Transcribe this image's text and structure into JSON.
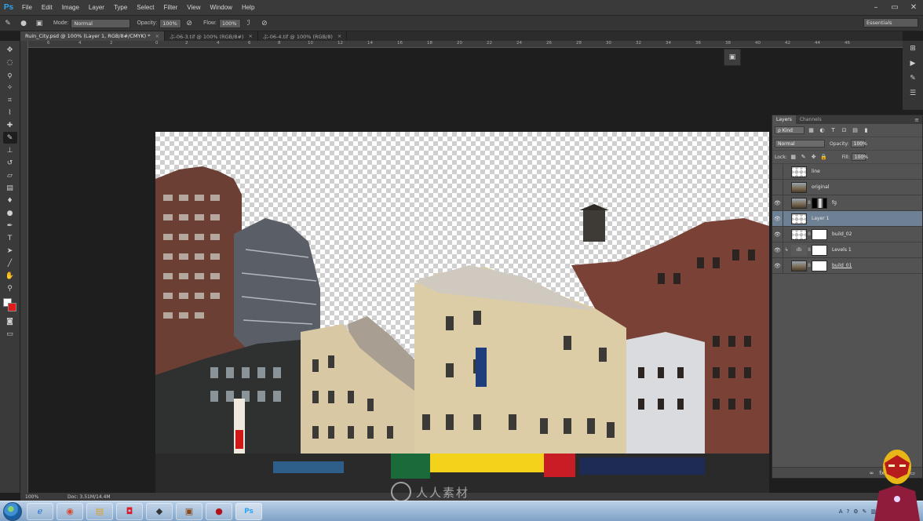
{
  "app": {
    "logo": "Ps"
  },
  "menu": [
    "File",
    "Edit",
    "Image",
    "Layer",
    "Type",
    "Select",
    "Filter",
    "View",
    "Window",
    "Help"
  ],
  "window_controls": [
    "–",
    "▭",
    "✕"
  ],
  "options": {
    "mode_label": "Mode:",
    "mode_value": "Normal",
    "opacity_label": "Opacity:",
    "opacity_value": "100%",
    "flow_label": "Flow:",
    "flow_value": "100%",
    "workspace": "Essentials"
  },
  "tabs": [
    {
      "label": "Ruin_City.psd @ 100% (Layer 1, RGB/8#/CMYK) *",
      "close": "×"
    },
    {
      "label": "ぶ-06-3.tif @ 100% (RGB/8#)",
      "close": "×"
    },
    {
      "label": "ぶ-06-4.tif @ 100% (RGB/8)",
      "close": "×"
    }
  ],
  "ruler": [
    "6",
    "4",
    "2",
    "0",
    "2",
    "4",
    "6",
    "8",
    "10",
    "12",
    "14",
    "16",
    "18",
    "20",
    "22",
    "24",
    "26",
    "28",
    "30",
    "32",
    "34",
    "36",
    "38",
    "40",
    "42",
    "44",
    "46"
  ],
  "layers_panel": {
    "tabs": [
      "Layers",
      "Channels"
    ],
    "menu": "≡",
    "kind": "ρ Kind",
    "blend": "Normal",
    "opacity_label": "Opacity:",
    "opacity_value": "100%",
    "lock_label": "Lock:",
    "fill_label": "Fill:",
    "fill_value": "100%",
    "layers": [
      {
        "name": "line",
        "visible": false
      },
      {
        "name": "original",
        "visible": false
      },
      {
        "name": "fg",
        "visible": true
      },
      {
        "name": "Layer 1",
        "visible": true
      },
      {
        "name": "build_02",
        "visible": true
      },
      {
        "name": "Levels 1",
        "visible": true
      },
      {
        "name": "build_01",
        "visible": true
      }
    ]
  },
  "status": {
    "zoom": "100%",
    "doc": "Doc: 3.51M/14.4M"
  },
  "watermark": "人人素材",
  "colors": {
    "accent": "#2fa3f7",
    "selected_layer": "#6e8093",
    "bg_swatch": "#e11b1b"
  }
}
